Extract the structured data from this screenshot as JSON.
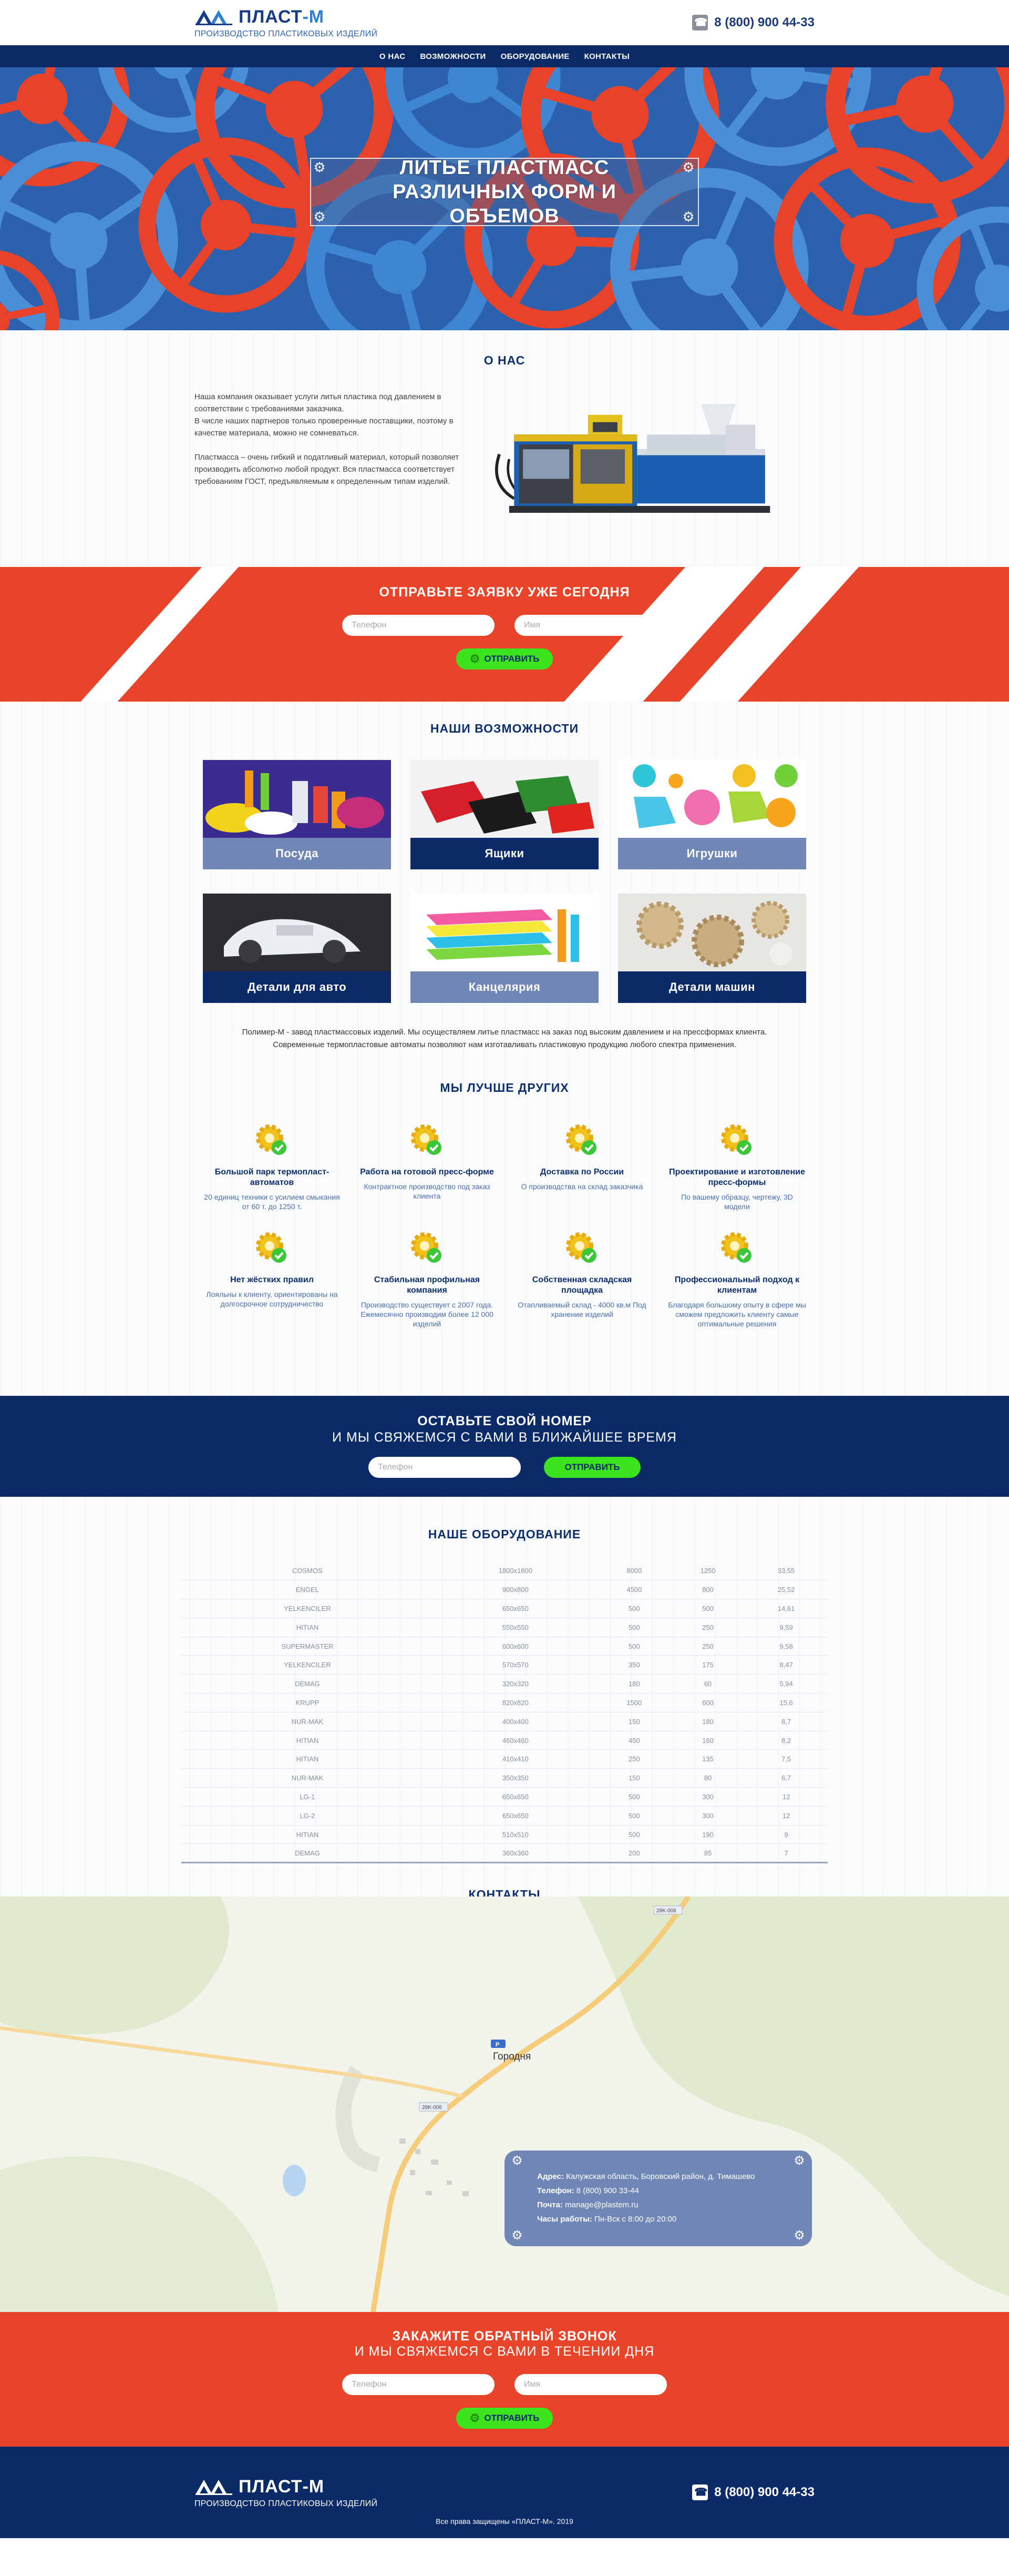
{
  "header": {
    "logo_name_a": "ПЛАСТ",
    "logo_name_b": "-М",
    "logo_sub": "ПРОИЗВОДСТВО ПЛАСТИКОВЫХ ИЗДЕЛИЙ",
    "phone": "8 (800) 900 44-33"
  },
  "nav": [
    "О НАС",
    "ВОЗМОЖНОСТИ",
    "ОБОРУДОВАНИЕ",
    "КОНТАКТЫ"
  ],
  "hero": {
    "line1": "ЛИТЬЕ ПЛАСТМАСС",
    "line2": "РАЗЛИЧНЫХ ФОРМ И ОБЪЕМОВ"
  },
  "about": {
    "title": "О НАС",
    "p1": "Наша компания оказывает услуги литья пластика под давлением в соответствии с требованиями заказчика.",
    "p2": "В числе наших партнеров только проверенные поставщики, поэтому в качестве материала, можно не сомневаться.",
    "p3": "Пластмасса – очень гибкий и податливый материал, который позволяет производить абсолютно любой продукт. Вся пластмасса соответствует требованиям ГОСТ, предъявляемым к определенным типам изделий."
  },
  "order_form": {
    "title": "ОТПРАВЬТЕ ЗАЯВКУ УЖЕ СЕГОДНЯ",
    "phone_placeholder": "Телефон",
    "name_placeholder": "Имя",
    "button": "ОТПРАВИТЬ"
  },
  "capabilities": {
    "title": "НАШИ ВОЗМОЖНОСТИ",
    "cards": [
      "Посуда",
      "Ящики",
      "Игрушки",
      "Детали для авто",
      "Канцелярия",
      "Детали машин"
    ],
    "desc1": "Полимер-М - завод пластмассовых изделий. Мы осуществляем литье пластмасс на заказ под высоким давлением и на прессформах клиента.",
    "desc2": "Современные термопластовые автоматы позволяют нам изготавливать пластиковую продукцию любого спектра применения."
  },
  "best": {
    "title": "МЫ ЛУЧШЕ ДРУГИХ",
    "items": [
      {
        "title": "Большой парк термопласт-автоматов",
        "desc": "20 единиц техники с усилием смыкания от 60 т. до 1250 т."
      },
      {
        "title": "Работа на готовой пресс-форме",
        "desc": "Контрактное производство под заказ клиента"
      },
      {
        "title": "Доставка по России",
        "desc": "О производства на склад заказчика"
      },
      {
        "title": "Проектирование и изготовление пресс-формы",
        "desc": "По вашему образцу, чертежу, 3D модели"
      },
      {
        "title": "Нет жёстких правил",
        "desc": "Лояльны к клиенту, ориентированы на долгосрочное сотрудничество"
      },
      {
        "title": "Стабильная профильная компания",
        "desc": "Производство существует с 2007 года. Ежемесячно производим более 12 000 изделий"
      },
      {
        "title": "Собственная складская площадка",
        "desc": "Отапливаемый склад - 4000 кв.м Под хранение изделий"
      },
      {
        "title": "Профессиональный подход к клиентам",
        "desc": "Благодаря большому опыту в сфере мы сможем предложить клиенту самые оптимальные решения"
      }
    ]
  },
  "callback_blue": {
    "line1": "ОСТАВЬТЕ СВОЙ НОМЕР",
    "line2": "И МЫ СВЯЖЕМСЯ С ВАМИ В БЛИЖАЙШЕЕ ВРЕМЯ",
    "phone_placeholder": "Телефон",
    "button": "ОТПРАВИТЬ"
  },
  "equipment": {
    "title": "НАШЕ ОБОРУДОВАНИЕ",
    "rows": [
      [
        "COSMOS",
        "1800x1800",
        "8000",
        "1250",
        "33,55"
      ],
      [
        "ENGEL",
        "900x800",
        "4500",
        "800",
        "25,52"
      ],
      [
        "YELKENCILER",
        "650x650",
        "500",
        "500",
        "14,61"
      ],
      [
        "HITIAN",
        "550x550",
        "500",
        "250",
        "9,59"
      ],
      [
        "SUPERMASTER",
        "600x600",
        "500",
        "250",
        "9,58"
      ],
      [
        "YELKENCILER",
        "570x570",
        "350",
        "175",
        "8,47"
      ],
      [
        "DEMAG",
        "320x320",
        "180",
        "60",
        "5,94"
      ],
      [
        "KRUPP",
        "820x820",
        "1500",
        "600",
        "15,6"
      ],
      [
        "NUR-MAK",
        "400x400",
        "150",
        "180",
        "8,7"
      ],
      [
        "HITIAN",
        "460x460",
        "450",
        "160",
        "8,2"
      ],
      [
        "HITIAN",
        "410x410",
        "250",
        "135",
        "7,5"
      ],
      [
        "NUR-MAK",
        "350x350",
        "150",
        "80",
        "6,7"
      ],
      [
        "LG-1",
        "650x650",
        "500",
        "300",
        "12"
      ],
      [
        "LG-2",
        "650x650",
        "500",
        "300",
        "12"
      ],
      [
        "HITIAN",
        "510x510",
        "500",
        "190",
        "9"
      ],
      [
        "DEMAG",
        "360x360",
        "200",
        "85",
        "7"
      ]
    ]
  },
  "contacts": {
    "title": "КОНТАКТЫ",
    "map_town": "Городня",
    "map_road1": "28K-006",
    "map_road2": "28K-006",
    "map_badge": "Р",
    "address_label": "Адрес:",
    "address": "Калужская область, Боровский район, д. Тимашево",
    "phone_label": "Телефон:",
    "phone": "8 (800) 900 33-44",
    "mail_label": "Почта:",
    "mail": "manage@plastem.ru",
    "hours_label": "Часы работы:",
    "hours": "Пн-Вск с 8:00 до 20:00"
  },
  "callback_orange": {
    "line1": "ЗАКАЖИТЕ ОБРАТНЫЙ ЗВОНОК",
    "line2": "И МЫ СВЯЖЕМСЯ С ВАМИ В ТЕЧЕНИИ ДНЯ",
    "phone_placeholder": "Телефон",
    "name_placeholder": "Имя",
    "button": "ОТПРАВИТЬ"
  },
  "footer": {
    "phone": "8 (800) 900 44-33",
    "copyright": "Все права защищены «ПЛАСТ-М». 2019"
  }
}
